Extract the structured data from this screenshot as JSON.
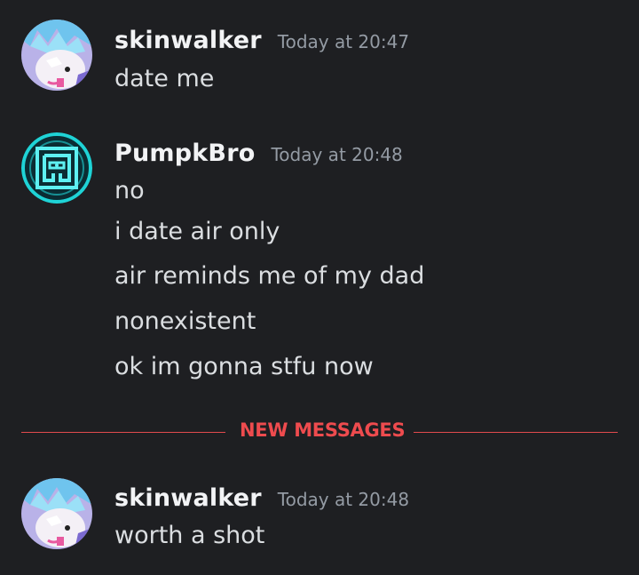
{
  "messages": [
    {
      "username": "skinwalker",
      "timestamp": "Today at 20:47",
      "lines": [
        "date me"
      ]
    },
    {
      "username": "PumpkBro",
      "timestamp": "Today at 20:48",
      "lines": [
        "no",
        "i date air only",
        "air reminds me of my dad",
        "nonexistent",
        "ok im gonna stfu now"
      ]
    },
    {
      "username": "skinwalker",
      "timestamp": "Today at 20:48",
      "lines": [
        "worth a shot"
      ]
    }
  ],
  "divider": {
    "label": "NEW MESSAGES",
    "color": "#ee4b4e"
  },
  "avatars": {
    "skinwalker": "anime-character-avatar",
    "pumpkbro": "maze-logo-avatar"
  },
  "colors": {
    "background": "#1e1f22",
    "username": "#f2f3f5",
    "message_text": "#dbdee1",
    "timestamp": "#949ba4",
    "accent_teal": "#1fd3d6"
  }
}
